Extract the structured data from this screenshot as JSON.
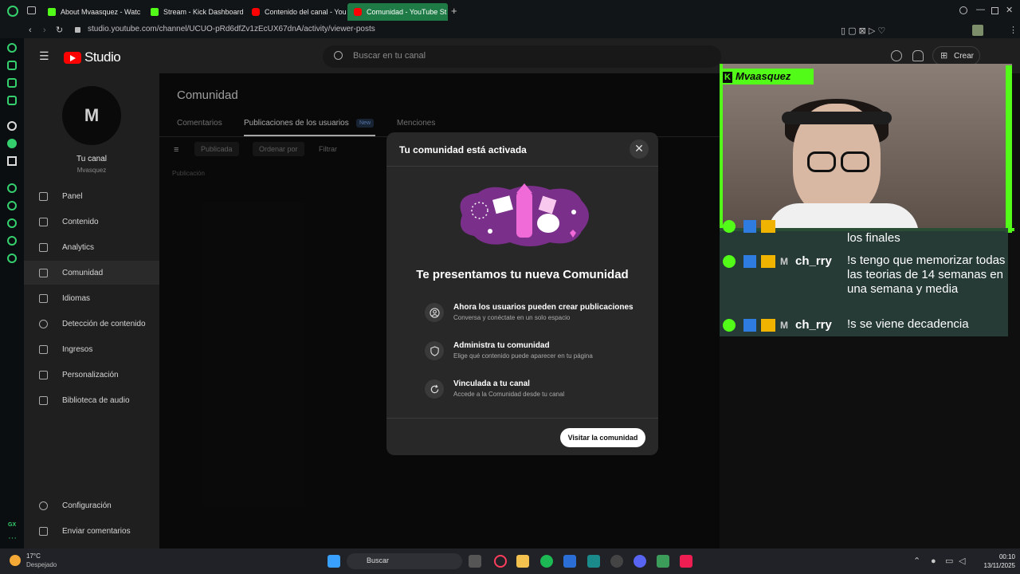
{
  "browser": {
    "tabs": [
      {
        "label": "About Mvaasquez - Watc",
        "kind": "kick"
      },
      {
        "label": "Stream - Kick Dashboard",
        "kind": "kick"
      },
      {
        "label": "Contenido del canal - You",
        "kind": "yt"
      },
      {
        "label": "Comunidad - YouTube St",
        "kind": "yt"
      }
    ],
    "url": "studio.youtube.com/channel/UCUO-pRd6dfZv1zEcUX67dnA/activity/viewer-posts"
  },
  "studio": {
    "logo_text": "Studio",
    "search_placeholder": "Buscar en tu canal",
    "create_label": "Crear"
  },
  "sidebar": {
    "avatar_letters": "M",
    "channel_title": "Tu canal",
    "channel_handle": "Mvasquez",
    "items": [
      {
        "label": "Panel",
        "icon": "dashboard-icon"
      },
      {
        "label": "Contenido",
        "icon": "content-icon"
      },
      {
        "label": "Analytics",
        "icon": "analytics-icon"
      },
      {
        "label": "Comunidad",
        "icon": "community-icon",
        "active": true
      },
      {
        "label": "Idiomas",
        "icon": "languages-icon"
      },
      {
        "label": "Detección de contenido",
        "icon": "copyright-icon"
      },
      {
        "label": "Ingresos",
        "icon": "dollar-icon"
      },
      {
        "label": "Personalización",
        "icon": "customize-icon"
      },
      {
        "label": "Biblioteca de audio",
        "icon": "audio-library-icon"
      }
    ],
    "bottom_items": [
      {
        "label": "Configuración",
        "icon": "settings-icon"
      },
      {
        "label": "Enviar comentarios",
        "icon": "feedback-icon"
      }
    ]
  },
  "main": {
    "title": "Comunidad",
    "tabs": [
      "Comentarios",
      "Publicaciones de los usuarios",
      "Menciones"
    ],
    "new_badge": "New",
    "filters": [
      "Publicada",
      "Ordenar por",
      "Filtrar"
    ],
    "column_header": "Publicación"
  },
  "modal": {
    "title": "Tu comunidad está activada",
    "heading": "Te presentamos tu nueva Comunidad",
    "features": [
      {
        "title": "Ahora los usuarios pueden crear publicaciones",
        "desc": "Conversa y conéctate en un solo espacio",
        "icon": "person-icon"
      },
      {
        "title": "Administra tu comunidad",
        "desc": "Elige qué contenido puede aparecer en tu página",
        "icon": "shield-icon"
      },
      {
        "title": "Vinculada a tu canal",
        "desc": "Accede a la Comunidad desde tu canal",
        "icon": "refresh-icon"
      }
    ],
    "button": "Visitar la comunidad"
  },
  "stream": {
    "name_tag": "Mvaasquez",
    "chat": [
      {
        "user": "ch_rry",
        "msg": "los finales"
      },
      {
        "user": "ch_rry",
        "msg": "!s tengo que memorizar todas las teorias de 14 semanas en una semana y media"
      },
      {
        "user": "ch_rry",
        "msg": "!s se viene decadencia"
      }
    ]
  },
  "taskbar": {
    "temp": "17°C",
    "weather": "Despejado",
    "search": "Buscar",
    "time": "00:10",
    "date": "13/11/2025"
  },
  "colors": {
    "kick_green": "#53fc18",
    "yt_red": "#ff0000",
    "opera_green": "#1e7b45"
  }
}
